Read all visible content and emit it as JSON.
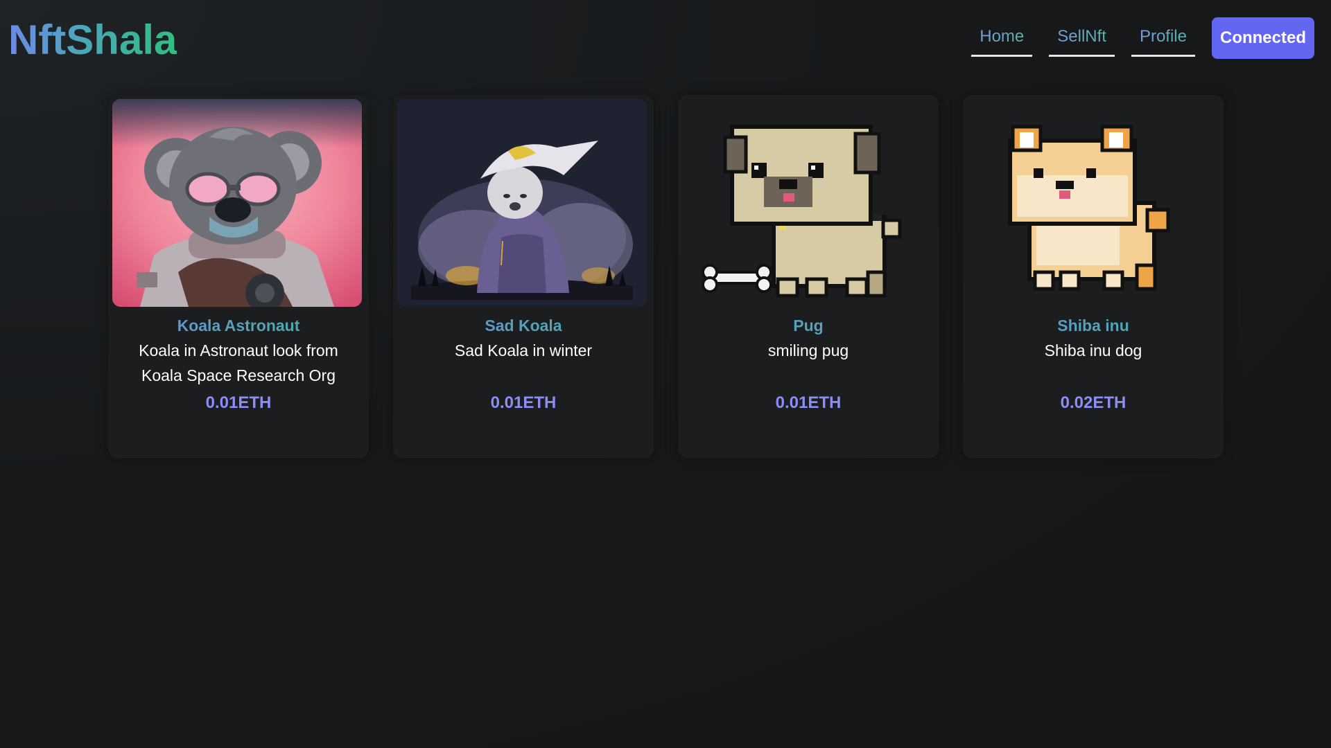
{
  "header": {
    "logo": "NftShala",
    "nav": {
      "home": "Home",
      "sell": "SellNft",
      "profile": "Profile",
      "connect": "Connected"
    }
  },
  "colors": {
    "accent": "#6366f1",
    "price": "#8b8ff5",
    "background": "#161718",
    "card": "#1c1d1f"
  },
  "nfts": [
    {
      "title": "Koala Astronaut",
      "description": "Koala in Astronaut look from Koala Space Research Org",
      "price": "0.01ETH",
      "image": "koala-astronaut-image"
    },
    {
      "title": "Sad Koala",
      "description": "Sad Koala in winter",
      "price": "0.01ETH",
      "image": "sad-koala-image"
    },
    {
      "title": "Pug",
      "description": "smiling pug",
      "price": "0.01ETH",
      "image": "pixel-pug-image"
    },
    {
      "title": "Shiba inu",
      "description": "Shiba inu dog",
      "price": "0.02ETH",
      "image": "pixel-shiba-image"
    }
  ]
}
